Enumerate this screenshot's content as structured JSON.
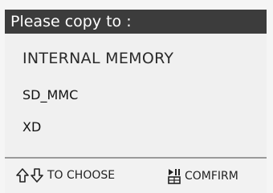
{
  "dialog": {
    "title": "Please copy to :"
  },
  "menu": {
    "items": [
      {
        "label": "INTERNAL MEMORY"
      },
      {
        "label": "SD_MMC"
      },
      {
        "label": "XD"
      }
    ]
  },
  "footer": {
    "choose": {
      "icon": "up-down-arrows-icon",
      "label": "TO CHOOSE"
    },
    "confirm": {
      "icon": "play-pause-confirm-icon",
      "label": "COMFIRM"
    }
  }
}
